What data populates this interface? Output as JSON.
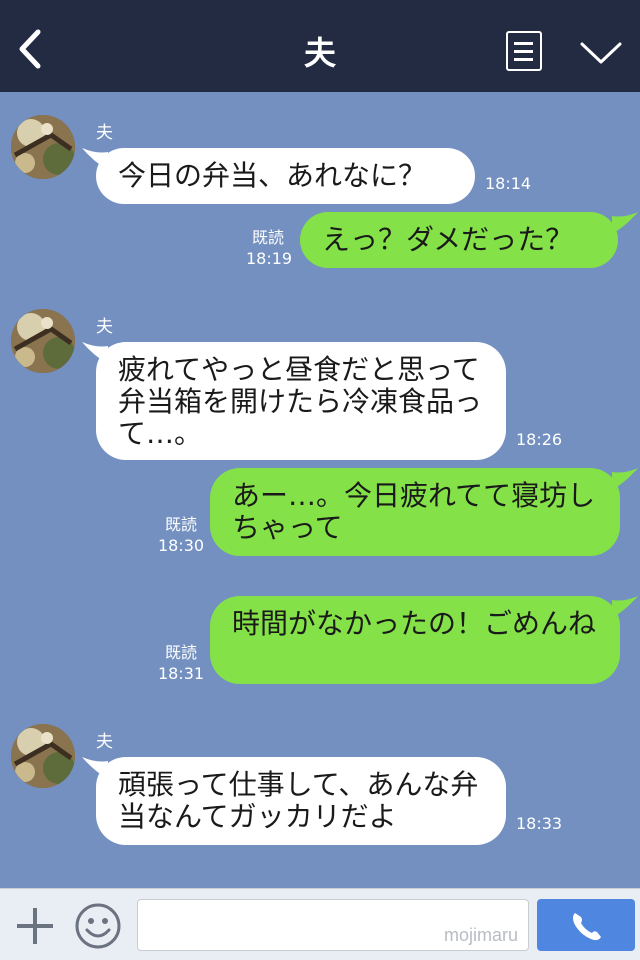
{
  "header": {
    "title": "夫",
    "back_icon": "chevron-left-icon",
    "notes_icon": "notes-icon",
    "menu_icon": "chevron-down-icon"
  },
  "messages": [
    {
      "side": "in",
      "sender": "夫",
      "text": "今日の弁当、あれなに？",
      "time": "18:14"
    },
    {
      "side": "out",
      "read": "既読",
      "text": "えっ？ダメだった？",
      "time": "18:19"
    },
    {
      "side": "in",
      "sender": "夫",
      "text": "疲れてやっと昼食だと思って弁当箱を開けたら冷凍食品って…。",
      "time": "18:26"
    },
    {
      "side": "out",
      "read": "既読",
      "text": "あー…。今日疲れてて寝坊しちゃって",
      "time": "18:30"
    },
    {
      "side": "out",
      "read": "既読",
      "text": "時間がなかったの！ごめんね",
      "time": "18:31"
    },
    {
      "side": "in",
      "sender": "夫",
      "text": "頑張って仕事して、あんな弁当なんてガッカリだよ",
      "time": "18:33"
    }
  ],
  "input": {
    "value": "",
    "watermark": "mojimaru"
  },
  "colors": {
    "header_bg": "#232b43",
    "chat_bg": "#7390c0",
    "bubble_in": "#ffffff",
    "bubble_out": "#84e148",
    "call_button": "#4f86e0"
  }
}
